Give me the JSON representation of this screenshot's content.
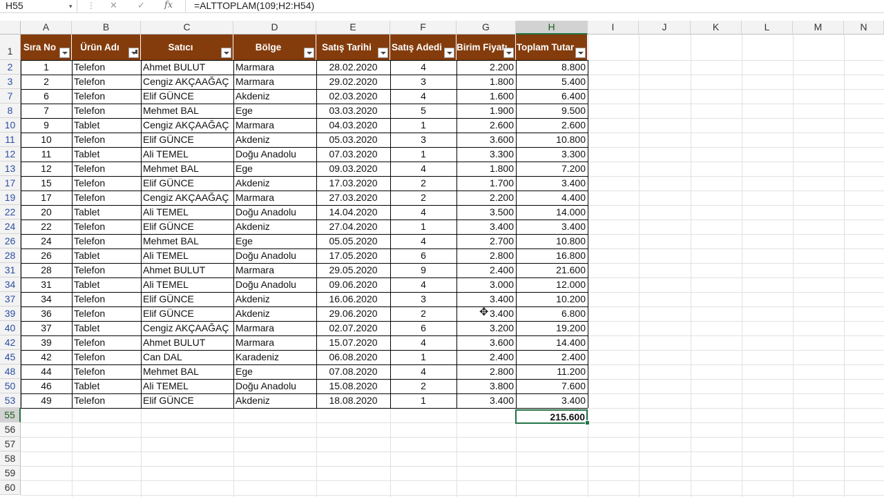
{
  "formula_bar": {
    "name_box": "H55",
    "name_box_arrow": "▾",
    "dots": "⋮",
    "cancel": "✕",
    "enter": "✓",
    "fx": "fx",
    "formula": "=ALTTOPLAM(109;H2:H54)"
  },
  "columns": [
    "A",
    "B",
    "C",
    "D",
    "E",
    "F",
    "G",
    "H",
    "I",
    "J",
    "K",
    "L",
    "M",
    "N"
  ],
  "headers": [
    "Sıra No",
    "Ürün Adı",
    "Satıcı",
    "Bölge",
    "Satış Tarihi",
    "Satış Adedi",
    "Birim Fiyatı",
    "Toplam Tutar"
  ],
  "rows": [
    {
      "rownum": "2",
      "sira": "1",
      "urun": "Telefon",
      "satici": "Ahmet BULUT",
      "bolge": "Marmara",
      "tarih": "28.02.2020",
      "adet": "4",
      "fiyat": "2.200",
      "tutar": "8.800"
    },
    {
      "rownum": "3",
      "sira": "2",
      "urun": "Telefon",
      "satici": "Cengiz AKÇAAĞAÇ",
      "bolge": "Marmara",
      "tarih": "29.02.2020",
      "adet": "3",
      "fiyat": "1.800",
      "tutar": "5.400"
    },
    {
      "rownum": "7",
      "sira": "6",
      "urun": "Telefon",
      "satici": "Elif GÜNCE",
      "bolge": "Akdeniz",
      "tarih": "02.03.2020",
      "adet": "4",
      "fiyat": "1.600",
      "tutar": "6.400"
    },
    {
      "rownum": "8",
      "sira": "7",
      "urun": "Telefon",
      "satici": "Mehmet BAL",
      "bolge": "Ege",
      "tarih": "03.03.2020",
      "adet": "5",
      "fiyat": "1.900",
      "tutar": "9.500"
    },
    {
      "rownum": "10",
      "sira": "9",
      "urun": "Tablet",
      "satici": "Cengiz AKÇAAĞAÇ",
      "bolge": "Marmara",
      "tarih": "04.03.2020",
      "adet": "1",
      "fiyat": "2.600",
      "tutar": "2.600"
    },
    {
      "rownum": "11",
      "sira": "10",
      "urun": "Telefon",
      "satici": "Elif GÜNCE",
      "bolge": "Akdeniz",
      "tarih": "05.03.2020",
      "adet": "3",
      "fiyat": "3.600",
      "tutar": "10.800"
    },
    {
      "rownum": "12",
      "sira": "11",
      "urun": "Tablet",
      "satici": "Ali TEMEL",
      "bolge": "Doğu Anadolu",
      "tarih": "07.03.2020",
      "adet": "1",
      "fiyat": "3.300",
      "tutar": "3.300"
    },
    {
      "rownum": "13",
      "sira": "12",
      "urun": "Telefon",
      "satici": "Mehmet BAL",
      "bolge": "Ege",
      "tarih": "09.03.2020",
      "adet": "4",
      "fiyat": "1.800",
      "tutar": "7.200"
    },
    {
      "rownum": "17",
      "sira": "15",
      "urun": "Telefon",
      "satici": "Elif GÜNCE",
      "bolge": "Akdeniz",
      "tarih": "17.03.2020",
      "adet": "2",
      "fiyat": "1.700",
      "tutar": "3.400"
    },
    {
      "rownum": "19",
      "sira": "17",
      "urun": "Telefon",
      "satici": "Cengiz AKÇAAĞAÇ",
      "bolge": "Marmara",
      "tarih": "27.03.2020",
      "adet": "2",
      "fiyat": "2.200",
      "tutar": "4.400"
    },
    {
      "rownum": "22",
      "sira": "20",
      "urun": "Tablet",
      "satici": "Ali TEMEL",
      "bolge": "Doğu Anadolu",
      "tarih": "14.04.2020",
      "adet": "4",
      "fiyat": "3.500",
      "tutar": "14.000"
    },
    {
      "rownum": "24",
      "sira": "22",
      "urun": "Telefon",
      "satici": "Elif GÜNCE",
      "bolge": "Akdeniz",
      "tarih": "27.04.2020",
      "adet": "1",
      "fiyat": "3.400",
      "tutar": "3.400"
    },
    {
      "rownum": "26",
      "sira": "24",
      "urun": "Telefon",
      "satici": "Mehmet BAL",
      "bolge": "Ege",
      "tarih": "05.05.2020",
      "adet": "4",
      "fiyat": "2.700",
      "tutar": "10.800"
    },
    {
      "rownum": "28",
      "sira": "26",
      "urun": "Tablet",
      "satici": "Ali TEMEL",
      "bolge": "Doğu Anadolu",
      "tarih": "17.05.2020",
      "adet": "6",
      "fiyat": "2.800",
      "tutar": "16.800"
    },
    {
      "rownum": "31",
      "sira": "28",
      "urun": "Telefon",
      "satici": "Ahmet BULUT",
      "bolge": "Marmara",
      "tarih": "29.05.2020",
      "adet": "9",
      "fiyat": "2.400",
      "tutar": "21.600"
    },
    {
      "rownum": "34",
      "sira": "31",
      "urun": "Tablet",
      "satici": "Ali TEMEL",
      "bolge": "Doğu Anadolu",
      "tarih": "09.06.2020",
      "adet": "4",
      "fiyat": "3.000",
      "tutar": "12.000"
    },
    {
      "rownum": "37",
      "sira": "34",
      "urun": "Telefon",
      "satici": "Elif GÜNCE",
      "bolge": "Akdeniz",
      "tarih": "16.06.2020",
      "adet": "3",
      "fiyat": "3.400",
      "tutar": "10.200"
    },
    {
      "rownum": "39",
      "sira": "36",
      "urun": "Telefon",
      "satici": "Elif GÜNCE",
      "bolge": "Akdeniz",
      "tarih": "29.06.2020",
      "adet": "2",
      "fiyat": "3.400",
      "tutar": "6.800"
    },
    {
      "rownum": "40",
      "sira": "37",
      "urun": "Tablet",
      "satici": "Cengiz AKÇAAĞAÇ",
      "bolge": "Marmara",
      "tarih": "02.07.2020",
      "adet": "6",
      "fiyat": "3.200",
      "tutar": "19.200"
    },
    {
      "rownum": "42",
      "sira": "39",
      "urun": "Telefon",
      "satici": "Ahmet BULUT",
      "bolge": "Marmara",
      "tarih": "15.07.2020",
      "adet": "4",
      "fiyat": "3.600",
      "tutar": "14.400"
    },
    {
      "rownum": "45",
      "sira": "42",
      "urun": "Telefon",
      "satici": "Can DAL",
      "bolge": "Karadeniz",
      "tarih": "06.08.2020",
      "adet": "1",
      "fiyat": "2.400",
      "tutar": "2.400"
    },
    {
      "rownum": "48",
      "sira": "44",
      "urun": "Telefon",
      "satici": "Mehmet BAL",
      "bolge": "Ege",
      "tarih": "07.08.2020",
      "adet": "4",
      "fiyat": "2.800",
      "tutar": "11.200"
    },
    {
      "rownum": "50",
      "sira": "46",
      "urun": "Tablet",
      "satici": "Ali TEMEL",
      "bolge": "Doğu Anadolu",
      "tarih": "15.08.2020",
      "adet": "2",
      "fiyat": "3.800",
      "tutar": "7.600"
    },
    {
      "rownum": "53",
      "sira": "49",
      "urun": "Telefon",
      "satici": "Elif GÜNCE",
      "bolge": "Akdeniz",
      "tarih": "18.08.2020",
      "adet": "1",
      "fiyat": "3.400",
      "tutar": "3.400"
    }
  ],
  "header_row_num": "1",
  "total_row_num": "55",
  "total": "215.600",
  "empty_rows": [
    "56",
    "57",
    "58",
    "59",
    "60"
  ],
  "cursor_icon": "✥",
  "colors": {
    "header_bg": "#843c0c",
    "selection": "#217346"
  }
}
